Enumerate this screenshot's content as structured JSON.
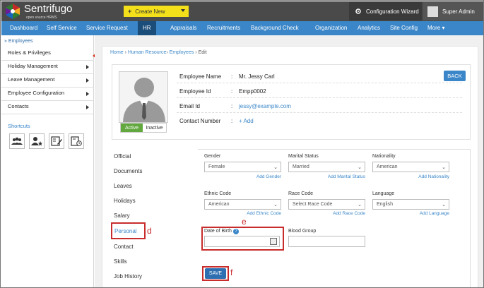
{
  "app": {
    "name": "Sentrifugo",
    "tagline": "open source HRMS"
  },
  "topbar": {
    "create_label": "Create New",
    "config_label": "Configuration Wizard",
    "user_label": "Super Admin"
  },
  "nav": {
    "items": [
      "Dashboard",
      "Self Service",
      "Service Request",
      "HR",
      "Appraisals",
      "Recruitments",
      "Background Check",
      "Organization",
      "Analytics",
      "Site Config",
      "More"
    ],
    "active": "HR"
  },
  "sidebar": {
    "header": "Employees",
    "items": [
      "Roles & Privileges",
      "Holiday Management",
      "Leave Management",
      "Employee Configuration",
      "Contacts"
    ],
    "shortcuts_title": "Shortcuts"
  },
  "breadcrumb": {
    "home": "Home",
    "sep1": "›",
    "hr": "Human Resource",
    "sep2": "›",
    "employees": "Employees",
    "sep3": "›",
    "current": "Edit"
  },
  "profile": {
    "status_active": "Active",
    "status_inactive": "Inactive",
    "back_label": "BACK",
    "fields": [
      {
        "label": "Employee Name",
        "value": "Mr. Jessy Carl"
      },
      {
        "label": "Employee Id",
        "value": "Empp0002"
      },
      {
        "label": "Email Id",
        "value": "jessy@example.com"
      },
      {
        "label": "Contact Number",
        "value": "+ Add"
      }
    ]
  },
  "tabs": [
    "Official",
    "Documents",
    "Leaves",
    "Holidays",
    "Salary",
    "Personal",
    "Contact",
    "Skills",
    "Job History"
  ],
  "form": {
    "gender": {
      "label": "Gender",
      "value": "Female",
      "add": "Add Gender"
    },
    "marital": {
      "label": "Marital Status",
      "value": "Married",
      "add": "Add Marital Status"
    },
    "nationality": {
      "label": "Nationality",
      "value": "American",
      "add": "Add Nationality"
    },
    "ethnic": {
      "label": "Ethnic Code",
      "value": "American",
      "add": "Add Ethnic Code"
    },
    "race": {
      "label": "Race Code",
      "value": "Select Race Code",
      "add": "Add Race Code"
    },
    "language": {
      "label": "Language",
      "value": "English",
      "add": "Add Language"
    },
    "dob": {
      "label": "Date of Birth"
    },
    "blood": {
      "label": "Blood Group"
    },
    "save_label": "SAVE"
  },
  "annotations": {
    "d": "d",
    "e": "e",
    "f": "f"
  },
  "colors": {
    "nav": "#3a86c8",
    "accent_yellow": "#f3e01b",
    "annotation": "#c92c2c",
    "active_green": "#62a83f"
  }
}
